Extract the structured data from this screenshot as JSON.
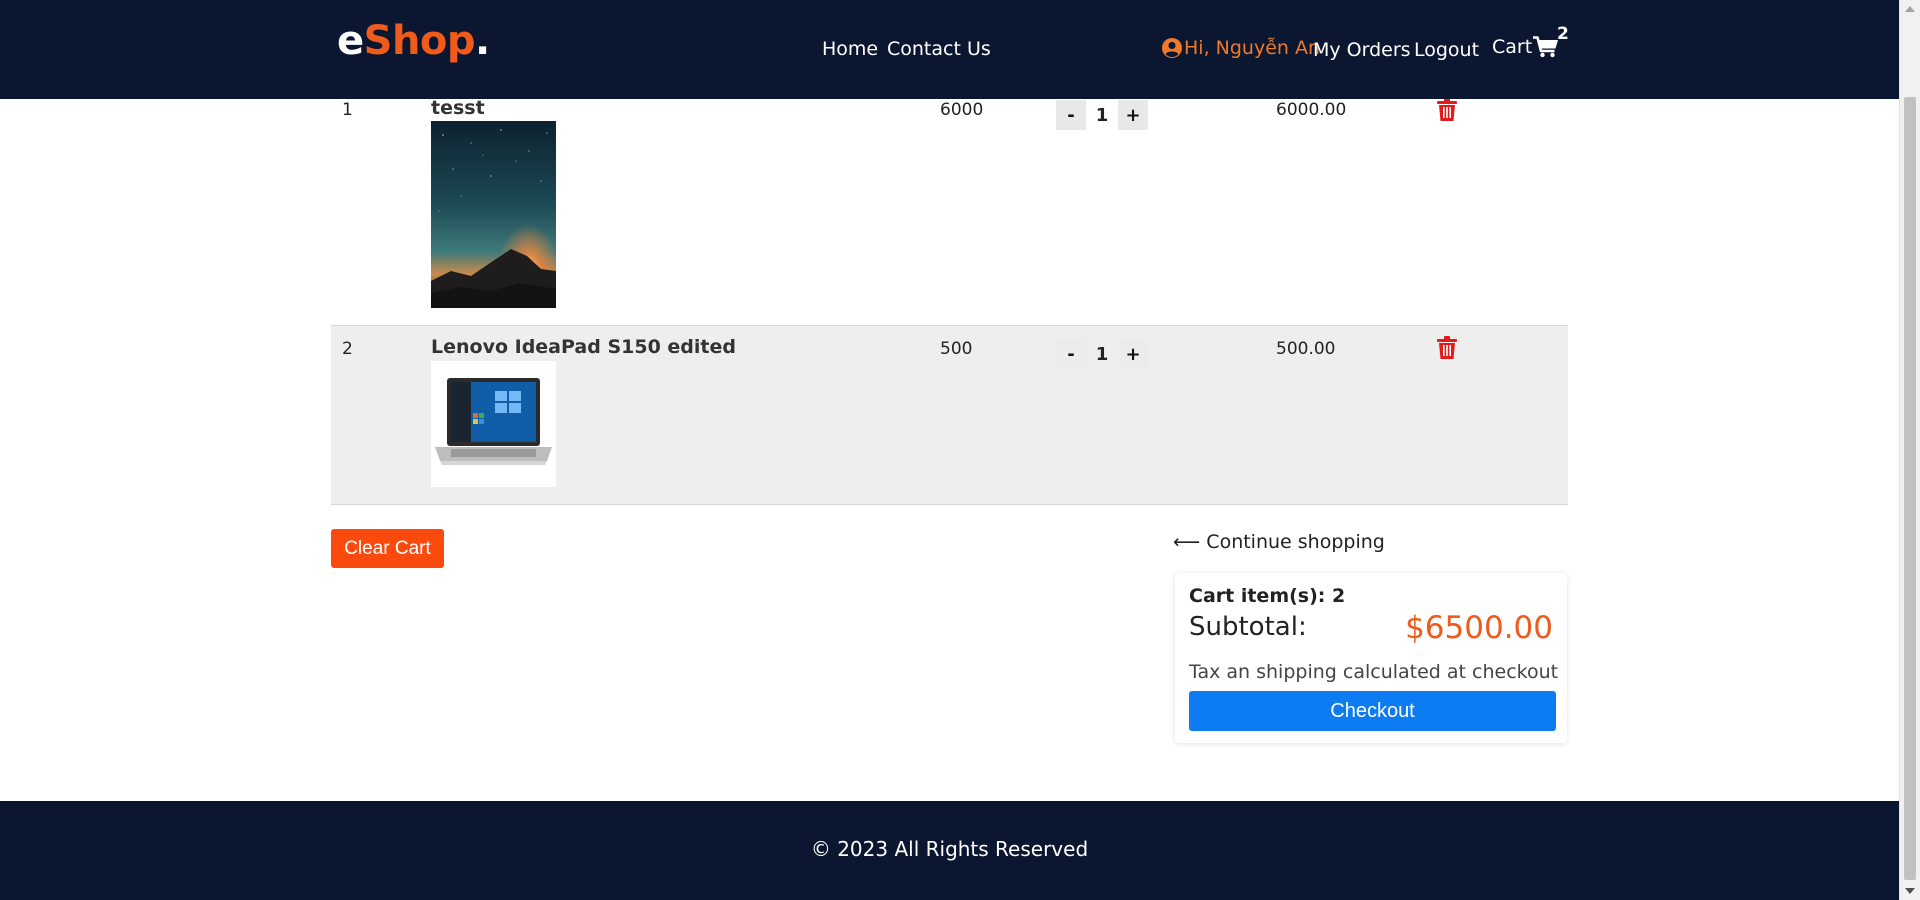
{
  "header": {
    "logo_prefix": "e",
    "logo_main": "Shop",
    "logo_dot": ".",
    "nav": {
      "home": "Home",
      "contact": "Contact Us",
      "greeting": "Hi, Nguyễn An",
      "my_orders": "My Orders",
      "logout": "Logout",
      "cart": "Cart",
      "cart_count": "2"
    },
    "icons": {
      "user": "user-circle-icon",
      "cart": "shopping-cart-icon"
    }
  },
  "cart": {
    "rows": [
      {
        "index": "1",
        "name": "tesst",
        "price": "6000",
        "quantity": "1",
        "total": "6000.00",
        "image": "night-sky-landscape"
      },
      {
        "index": "2",
        "name": "Lenovo IdeaPad S150 edited",
        "price": "500",
        "quantity": "1",
        "total": "500.00",
        "image": "laptop"
      }
    ],
    "decrement_label": "-",
    "increment_label": "+",
    "clear_label": "Clear Cart",
    "continue_label": "Continue shopping"
  },
  "summary": {
    "items_label": "Cart item(s): 2",
    "subtotal_label": "Subtotal:",
    "subtotal_value": "$6500.00",
    "note": "Tax an shipping calculated at checkout",
    "checkout_label": "Checkout"
  },
  "footer": {
    "text": "© 2023 All Rights Reserved"
  },
  "colors": {
    "header_bg": "#0b1730",
    "accent": "#f05a1a",
    "clear_button": "#fa4a0e",
    "checkout_button": "#0d7cf2",
    "delete_icon": "#e31b1b"
  }
}
